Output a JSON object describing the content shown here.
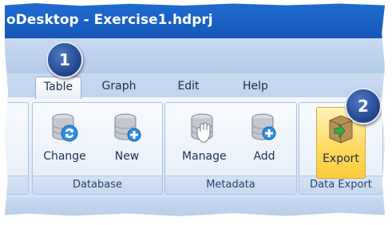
{
  "window": {
    "title": "oDesktop - Exercise1.hdprj"
  },
  "tabs": [
    {
      "label": "Table",
      "active": true
    },
    {
      "label": "Graph",
      "active": false
    },
    {
      "label": "Edit",
      "active": false
    },
    {
      "label": "Help",
      "active": false
    }
  ],
  "groups": {
    "database": {
      "label": "Database",
      "buttons": [
        {
          "label": "Change",
          "icon": "database-sync-icon"
        },
        {
          "label": "New",
          "icon": "database-add-icon"
        }
      ]
    },
    "metadata": {
      "label": "Metadata",
      "buttons": [
        {
          "label": "Manage",
          "icon": "database-hand-icon"
        },
        {
          "label": "Add",
          "icon": "database-add-icon"
        }
      ]
    },
    "data_export": {
      "label": "Data Export",
      "buttons": [
        {
          "label": "Export",
          "icon": "export-box-icon",
          "highlighted": true
        }
      ]
    }
  },
  "callouts": [
    {
      "label": "1"
    },
    {
      "label": "2"
    }
  ],
  "colors": {
    "title_bar": "#1557b8",
    "ribbon": "#dce8f6",
    "highlight": "#ffd95c",
    "callout": "#1e4489"
  }
}
